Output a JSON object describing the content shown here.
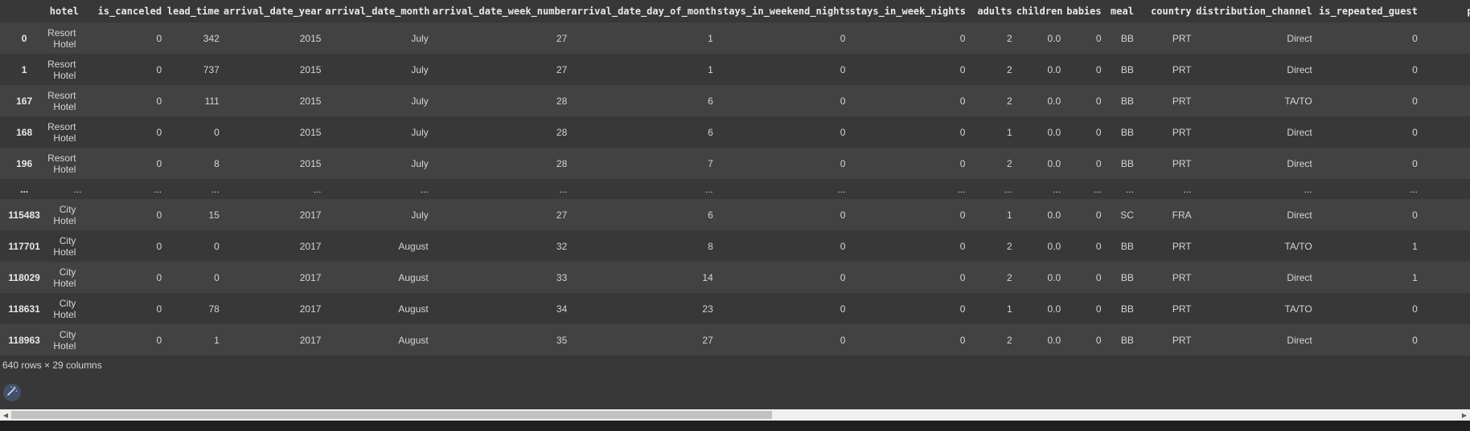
{
  "columns": [
    "",
    "hotel",
    "is_canceled",
    "lead_time",
    "arrival_date_year",
    "arrival_date_month",
    "arrival_date_week_number",
    "arrival_date_day_of_month",
    "stays_in_weekend_nights",
    "stays_in_week_nights",
    "adults",
    "children",
    "babies",
    "meal",
    "country",
    "distribution_channel",
    "is_repeated_guest",
    "previou"
  ],
  "rows": [
    {
      "index": "0",
      "cells": [
        "Resort Hotel",
        "0",
        "342",
        "2015",
        "July",
        "27",
        "1",
        "0",
        "0",
        "2",
        "0.0",
        "0",
        "BB",
        "PRT",
        "Direct",
        "0",
        ""
      ]
    },
    {
      "index": "1",
      "cells": [
        "Resort Hotel",
        "0",
        "737",
        "2015",
        "July",
        "27",
        "1",
        "0",
        "0",
        "2",
        "0.0",
        "0",
        "BB",
        "PRT",
        "Direct",
        "0",
        ""
      ]
    },
    {
      "index": "167",
      "cells": [
        "Resort Hotel",
        "0",
        "111",
        "2015",
        "July",
        "28",
        "6",
        "0",
        "0",
        "2",
        "0.0",
        "0",
        "BB",
        "PRT",
        "TA/TO",
        "0",
        ""
      ]
    },
    {
      "index": "168",
      "cells": [
        "Resort Hotel",
        "0",
        "0",
        "2015",
        "July",
        "28",
        "6",
        "0",
        "0",
        "1",
        "0.0",
        "0",
        "BB",
        "PRT",
        "Direct",
        "0",
        ""
      ]
    },
    {
      "index": "196",
      "cells": [
        "Resort Hotel",
        "0",
        "8",
        "2015",
        "July",
        "28",
        "7",
        "0",
        "0",
        "2",
        "0.0",
        "0",
        "BB",
        "PRT",
        "Direct",
        "0",
        ""
      ]
    },
    {
      "index": "...",
      "ellipsis": true,
      "cells": [
        "...",
        "...",
        "...",
        "...",
        "...",
        "...",
        "...",
        "...",
        "...",
        "...",
        "...",
        "...",
        "...",
        "...",
        "...",
        "...",
        "..."
      ]
    },
    {
      "index": "115483",
      "cells": [
        "City Hotel",
        "0",
        "15",
        "2017",
        "July",
        "27",
        "6",
        "0",
        "0",
        "1",
        "0.0",
        "0",
        "SC",
        "FRA",
        "Direct",
        "0",
        ""
      ]
    },
    {
      "index": "117701",
      "cells": [
        "City Hotel",
        "0",
        "0",
        "2017",
        "August",
        "32",
        "8",
        "0",
        "0",
        "2",
        "0.0",
        "0",
        "BB",
        "PRT",
        "TA/TO",
        "1",
        ""
      ]
    },
    {
      "index": "118029",
      "cells": [
        "City Hotel",
        "0",
        "0",
        "2017",
        "August",
        "33",
        "14",
        "0",
        "0",
        "2",
        "0.0",
        "0",
        "BB",
        "PRT",
        "Direct",
        "1",
        ""
      ]
    },
    {
      "index": "118631",
      "cells": [
        "City Hotel",
        "0",
        "78",
        "2017",
        "August",
        "34",
        "23",
        "0",
        "0",
        "1",
        "0.0",
        "0",
        "BB",
        "PRT",
        "TA/TO",
        "0",
        ""
      ]
    },
    {
      "index": "118963",
      "cells": [
        "City Hotel",
        "0",
        "1",
        "2017",
        "August",
        "35",
        "27",
        "0",
        "0",
        "2",
        "0.0",
        "0",
        "BB",
        "PRT",
        "Direct",
        "0",
        ""
      ]
    }
  ],
  "summary": "640 rows × 29 columns",
  "icons": {
    "magic": "magic-wand-icon",
    "scroll_left": "arrow-left-icon",
    "scroll_right": "arrow-right-icon"
  },
  "colors": {
    "background": "#383838",
    "row_alt": "#424242",
    "text": "#d5d5d5",
    "button": "#44506a"
  }
}
